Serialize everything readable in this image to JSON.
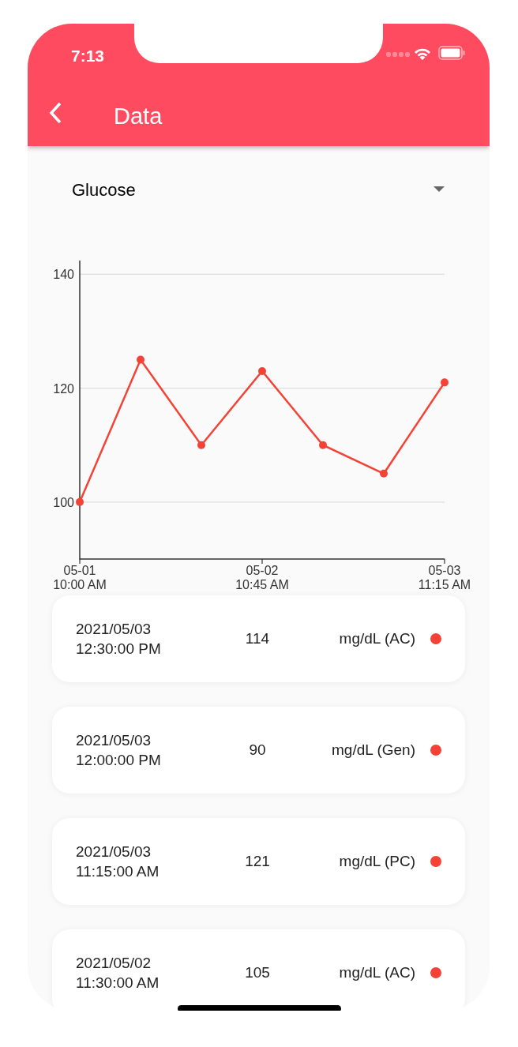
{
  "status_bar": {
    "time": "7:13"
  },
  "app_bar": {
    "title": "Data"
  },
  "dropdown": {
    "value": "Glucose"
  },
  "chart": {
    "chart_data": {
      "type": "line",
      "categories": [
        "05-01\n10:00 AM",
        null,
        null,
        "05-02\n10:45 AM",
        null,
        null,
        "05-03\n11:15 AM"
      ],
      "series": [
        {
          "color": "#f44336",
          "marker": true,
          "values": [
            100,
            125,
            110,
            123,
            110,
            105,
            121
          ]
        }
      ],
      "grid": true,
      "ylim": [
        90,
        142.4
      ],
      "yticks": [
        100,
        120,
        140
      ]
    }
  },
  "records": [
    {
      "date": "2021/05/03",
      "time": "12:30:00 PM",
      "value": "114",
      "unit": "mg/dL (AC)",
      "color": "#f44336"
    },
    {
      "date": "2021/05/03",
      "time": "12:00:00 PM",
      "value": "90",
      "unit": "mg/dL (Gen)",
      "color": "#f44336"
    },
    {
      "date": "2021/05/03",
      "time": "11:15:00 AM",
      "value": "121",
      "unit": "mg/dL (PC)",
      "color": "#f44336"
    },
    {
      "date": "2021/05/02",
      "time": "11:30:00 AM",
      "value": "105",
      "unit": "mg/dL (AC)",
      "color": "#f44336"
    }
  ]
}
